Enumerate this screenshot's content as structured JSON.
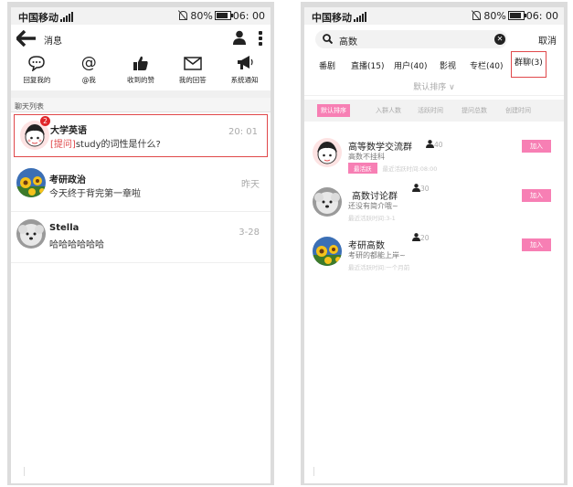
{
  "status_bar": {
    "carrier": "中国移动",
    "battery": "80%",
    "time": "06: 00"
  },
  "left": {
    "header_title": "消息",
    "quick_actions": [
      {
        "label": "回复我的",
        "icon": "comment-icon"
      },
      {
        "label": "@我",
        "icon": "at-icon"
      },
      {
        "label": "收到的赞",
        "icon": "thumbs-up-icon"
      },
      {
        "label": "我的回答",
        "icon": "envelope-icon"
      },
      {
        "label": "系统通知",
        "icon": "megaphone-icon"
      }
    ],
    "section_title": "聊天列表",
    "chats": [
      {
        "name": "大学英语",
        "tag": "[提问]",
        "message": "study的词性是什么?",
        "time": "20: 01",
        "badge": "2",
        "selected": true,
        "avatar": "cartoon-girl"
      },
      {
        "name": "考研政治",
        "message": "今天终于背完第一章啦",
        "time": "昨天",
        "avatar": "sunflower"
      },
      {
        "name": "Stella",
        "message": "哈哈哈哈哈哈",
        "time": "3-28",
        "avatar": "dog"
      }
    ]
  },
  "right": {
    "search_query": "高数",
    "cancel_label": "取消",
    "tabs": [
      "番剧",
      "直播(15)",
      "用户(40)",
      "影视",
      "专栏(40)",
      "群聊(3)"
    ],
    "active_tab": 5,
    "sort_label": "默认排序",
    "filters": [
      "默认排序",
      "入群人数",
      "活跃时间",
      "提问总数",
      "创建时间"
    ],
    "groups": [
      {
        "name": "高等数学交流群",
        "members": "40",
        "desc": "高数不挂科",
        "hot_label": "最活跃",
        "active": "最近活跃时间:08:00",
        "join": "加入",
        "avatar": "cartoon-girl"
      },
      {
        "name": "高数讨论群",
        "members": "30",
        "desc": "还没有简介哦~",
        "active": "最近活跃时间:3-1",
        "join": "加入",
        "avatar": "dog"
      },
      {
        "name": "考研高数",
        "members": "20",
        "desc": "考研的都能上岸~",
        "active": "最近活跃时间:一个月前",
        "join": "加入",
        "avatar": "sunflower"
      }
    ]
  },
  "colors": {
    "accent_red": "#e0484a",
    "badge_red": "#e0262a",
    "pink": "#f77fb4",
    "grey_text": "#aaaaaa"
  }
}
